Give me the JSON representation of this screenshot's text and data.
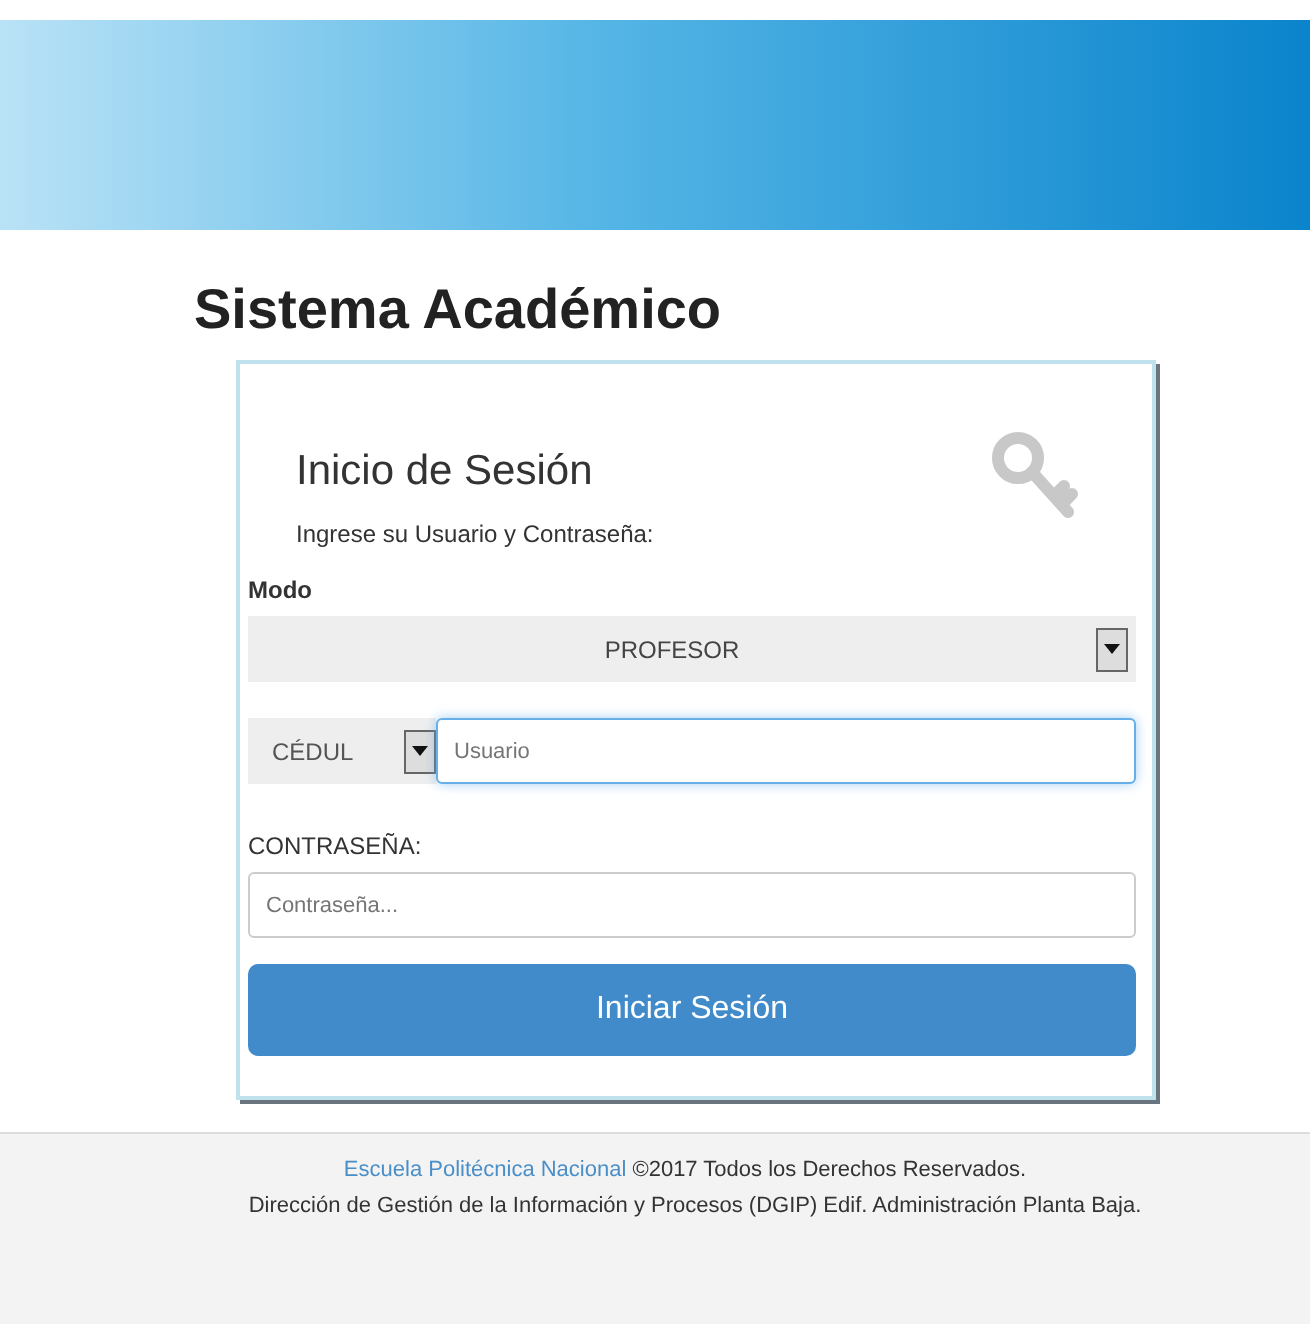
{
  "page_title": "Sistema Académico",
  "login": {
    "heading": "Inicio de Sesión",
    "subtitle": "Ingrese su Usuario y Contraseña:",
    "mode": {
      "label": "Modo",
      "value": "PROFESOR"
    },
    "id_type": {
      "value": "CÉDUL"
    },
    "username": {
      "placeholder": "Usuario",
      "focused": true
    },
    "password": {
      "label": "CONTRASEÑA:",
      "placeholder": "Contraseña..."
    },
    "submit": "Iniciar Sesión"
  },
  "footer": {
    "link": "Escuela Politécnica Nacional",
    "copyright": "©2017 Todos los Derechos Reservados.",
    "address": "Dirección de Gestión de la Información y Procesos (DGIP) Edif. Administración Planta Baja."
  }
}
